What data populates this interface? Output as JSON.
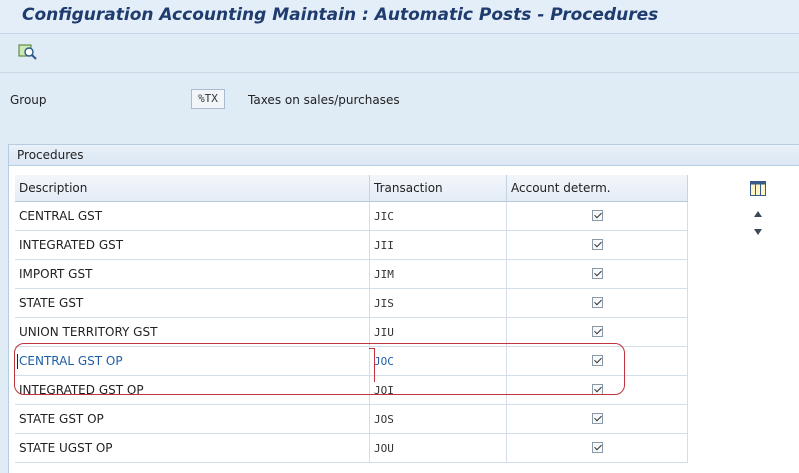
{
  "window": {
    "title": "Configuration Accounting Maintain : Automatic Posts - Procedures"
  },
  "toolbar": {
    "icons": [
      "details-icon"
    ]
  },
  "group": {
    "label": "Group",
    "value": "%TX",
    "description": "Taxes on sales/purchases"
  },
  "procedures": {
    "title": "Procedures",
    "columns": [
      "Description",
      "Transaction",
      "Account determ."
    ],
    "rows": [
      {
        "description": "CENTRAL GST",
        "transaction": "JIC",
        "account_determ": true
      },
      {
        "description": "INTEGRATED GST",
        "transaction": "JII",
        "account_determ": true
      },
      {
        "description": "IMPORT GST",
        "transaction": "JIM",
        "account_determ": true
      },
      {
        "description": "STATE GST",
        "transaction": "JIS",
        "account_determ": true
      },
      {
        "description": "UNION TERRITORY GST",
        "transaction": "JIU",
        "account_determ": true
      },
      {
        "description": "CENTRAL GST OP",
        "transaction": "JOC",
        "account_determ": true,
        "selected": true
      },
      {
        "description": "INTEGRATED GST OP",
        "transaction": "JOI",
        "account_determ": true
      },
      {
        "description": "STATE GST OP",
        "transaction": "JOS",
        "account_determ": true
      },
      {
        "description": "STATE UGST OP",
        "transaction": "JOU",
        "account_determ": true
      }
    ]
  },
  "colors": {
    "selection_highlight": "#c0333a",
    "selected_text": "#1f5fa8",
    "title_text": "#1f3c6e"
  }
}
